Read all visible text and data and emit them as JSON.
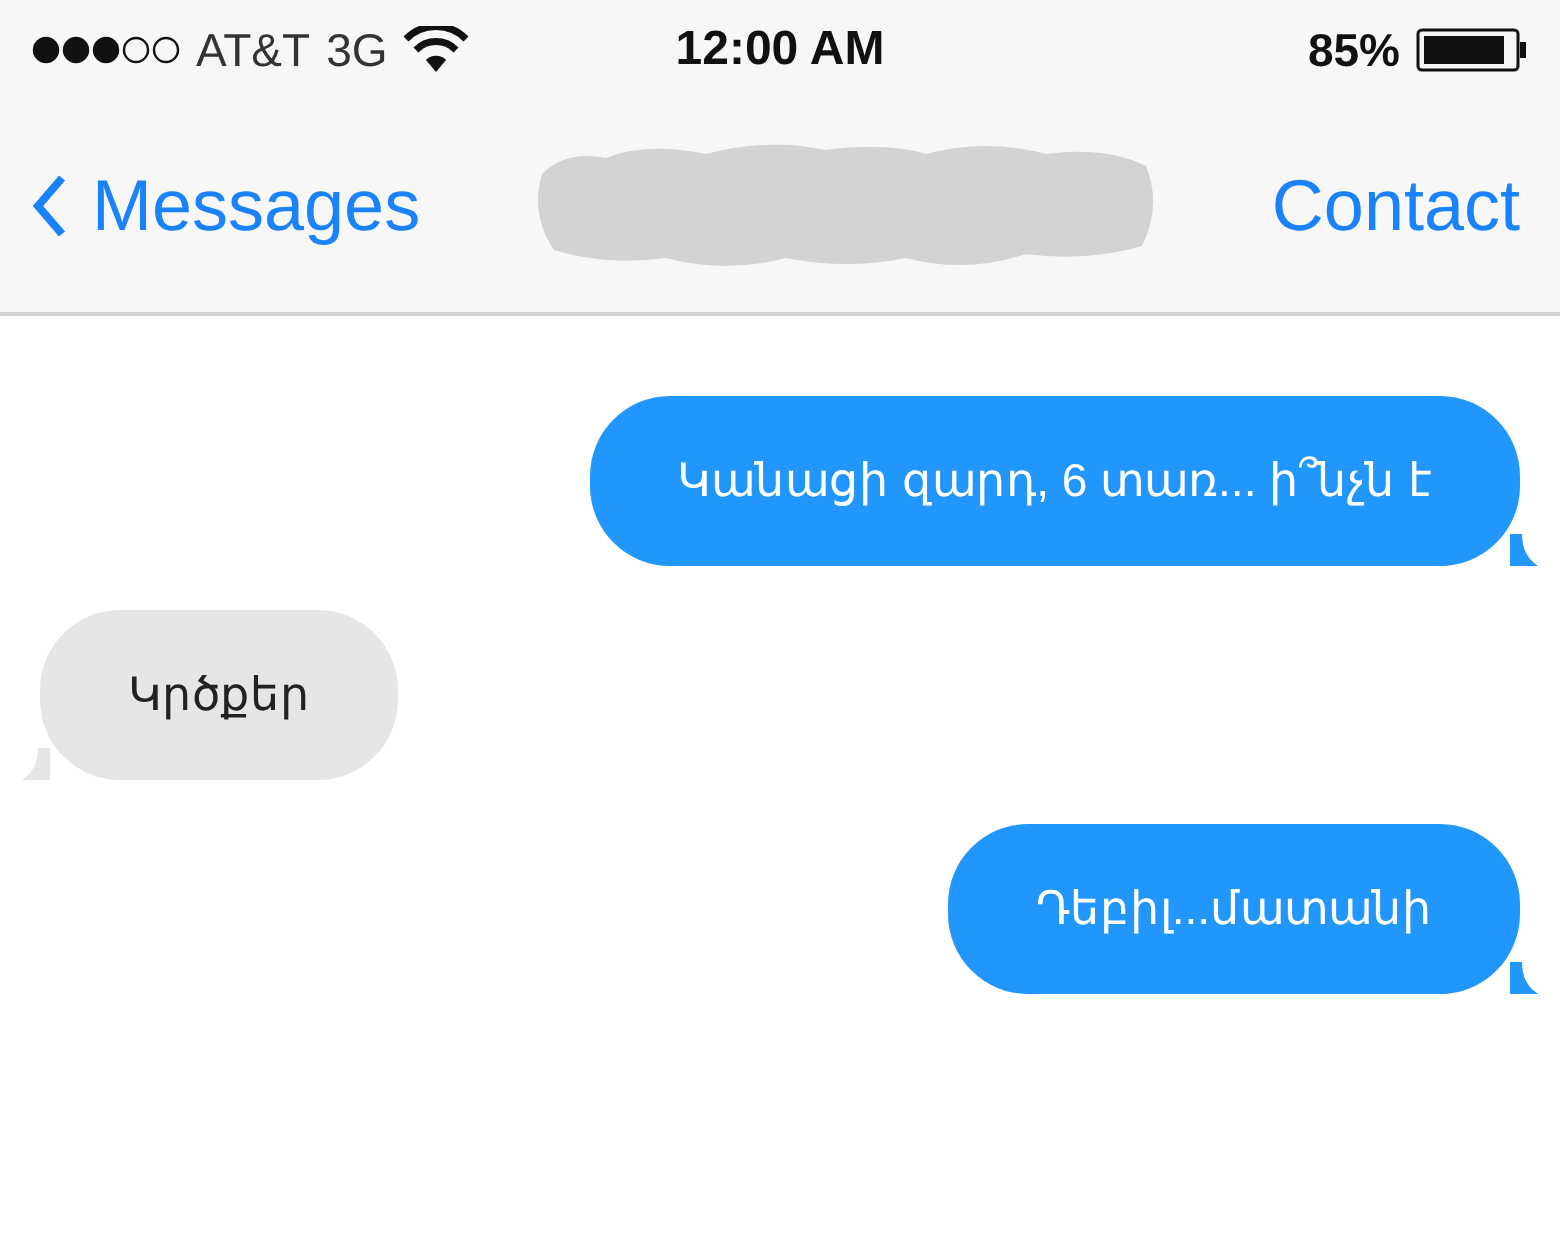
{
  "status_bar": {
    "carrier": "AT&T",
    "network": "3G",
    "time": "12:00 AM",
    "battery": "85%"
  },
  "nav_bar": {
    "back": "Messages",
    "action": "Contact"
  },
  "messages": [
    {
      "kind": "outgoing",
      "text": "Կանացի զարդ, 6 տառ... ի՞նչն է"
    },
    {
      "kind": "incoming",
      "text": "Կրծքեր"
    },
    {
      "kind": "outgoing",
      "text": "Դեբիլ...մատանի"
    }
  ]
}
